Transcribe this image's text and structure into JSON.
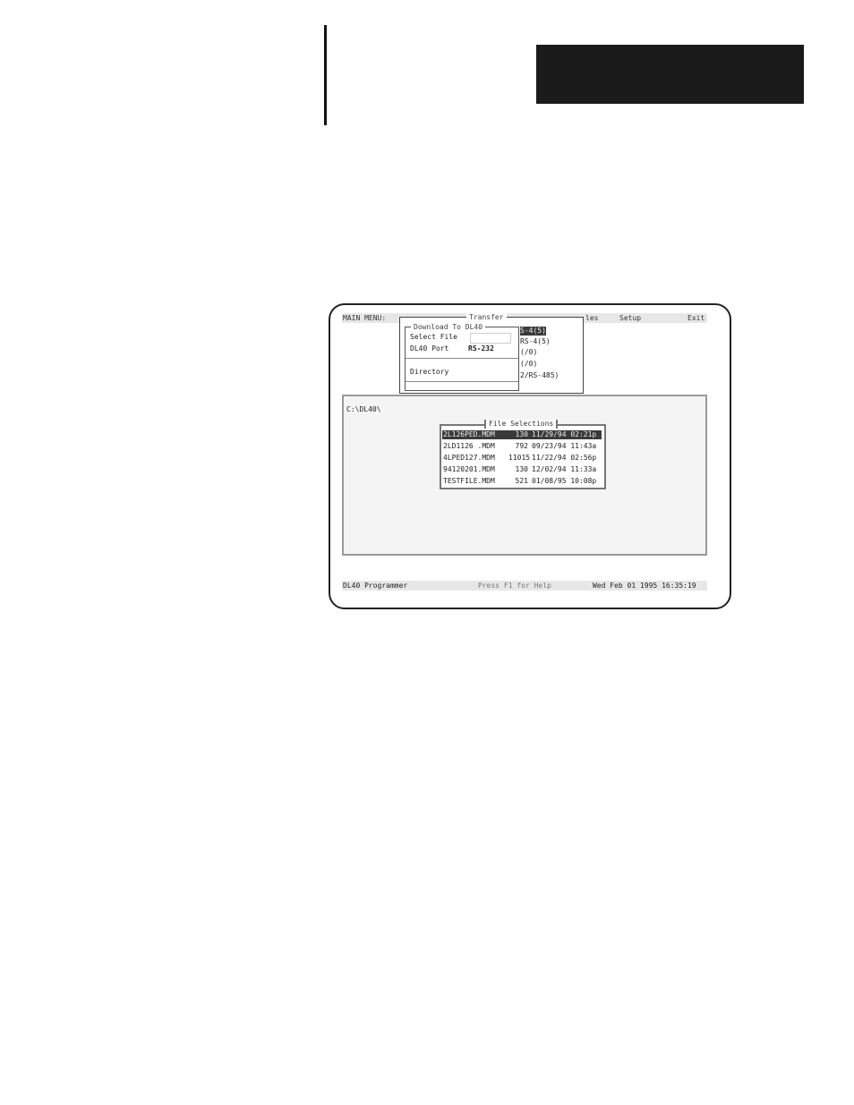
{
  "screen": {
    "menubar": {
      "main_menu": "MAIN MENU:",
      "files_fragment": "les",
      "setup": "Setup",
      "exit": "Exit"
    },
    "transfer": {
      "title": "Transfer",
      "download": {
        "title": "Download To DL40",
        "select_file_label": "Select File",
        "port_label": "DL40 Port",
        "port_value": "RS-232",
        "directory_label": "Directory"
      },
      "port_options": [
        "S-4(5)",
        "RS-4(5)",
        "(/0)",
        "(/0)",
        "2/RS-485)"
      ]
    },
    "directory": {
      "path": "C:\\DL40\\",
      "file_selections": {
        "title": "File Selections",
        "files": [
          {
            "name": "2L126PED.MDM",
            "size": "130",
            "datetime": "11/29/94 02:21p"
          },
          {
            "name": "2LD1126 .MDM",
            "size": "792",
            "datetime": "09/23/94 11:43a"
          },
          {
            "name": "4LPED127.MDM",
            "size": "11015",
            "datetime": "11/22/94 02:56p"
          },
          {
            "name": "94120201.MDM",
            "size": "130",
            "datetime": "12/02/94 11:33a"
          },
          {
            "name": "TESTFILE.MDM",
            "size": "521",
            "datetime": "01/08/95 10:08p"
          }
        ]
      }
    },
    "statusbar": {
      "app": "DL40 Programmer",
      "help": "Press F1 for Help",
      "datetime": "Wed Feb 01 1995 16:35:19"
    }
  }
}
